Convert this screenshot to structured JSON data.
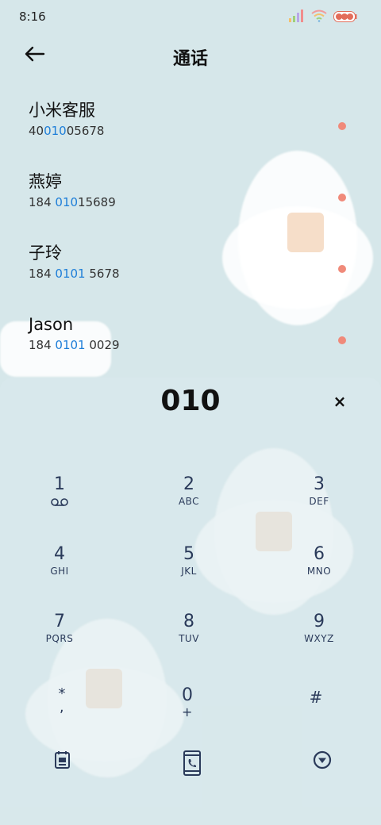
{
  "status": {
    "time": "8:16"
  },
  "header": {
    "title": "通话"
  },
  "results": [
    {
      "name": "小米客服",
      "number_pre": "40",
      "number_hl": "010",
      "number_post": "05678"
    },
    {
      "name": "燕婷",
      "number_pre": "184 ",
      "number_hl": "010",
      "number_post": "15689"
    },
    {
      "name": "子玲",
      "number_pre": "184 ",
      "number_hl": "0101",
      "number_post": " 5678"
    },
    {
      "name": "Jason",
      "number_pre": "184 ",
      "number_hl": "0101",
      "number_post": " 0029"
    }
  ],
  "dialer": {
    "display": "010",
    "clear_label": "×",
    "keys": [
      {
        "digit": "1",
        "letters": ""
      },
      {
        "digit": "2",
        "letters": "ABC"
      },
      {
        "digit": "3",
        "letters": "DEF"
      },
      {
        "digit": "4",
        "letters": "GHI"
      },
      {
        "digit": "5",
        "letters": "JKL"
      },
      {
        "digit": "6",
        "letters": "MNO"
      },
      {
        "digit": "7",
        "letters": "PQRS"
      },
      {
        "digit": "8",
        "letters": "TUV"
      },
      {
        "digit": "9",
        "letters": "WXYZ"
      },
      {
        "digit": "*",
        "letters": ","
      },
      {
        "digit": "0",
        "letters": "+"
      },
      {
        "digit": "#",
        "letters": ""
      }
    ]
  },
  "icons": {
    "back": "arrow-left-icon",
    "voicemail": "voicemail-icon",
    "contacts": "contacts-card-icon",
    "call": "phone-call-icon",
    "collapse": "chevron-down-circle-icon"
  },
  "colors": {
    "background": "#d6e7ea",
    "highlight": "#1e7ed8",
    "key_text": "#2a3a5a"
  }
}
